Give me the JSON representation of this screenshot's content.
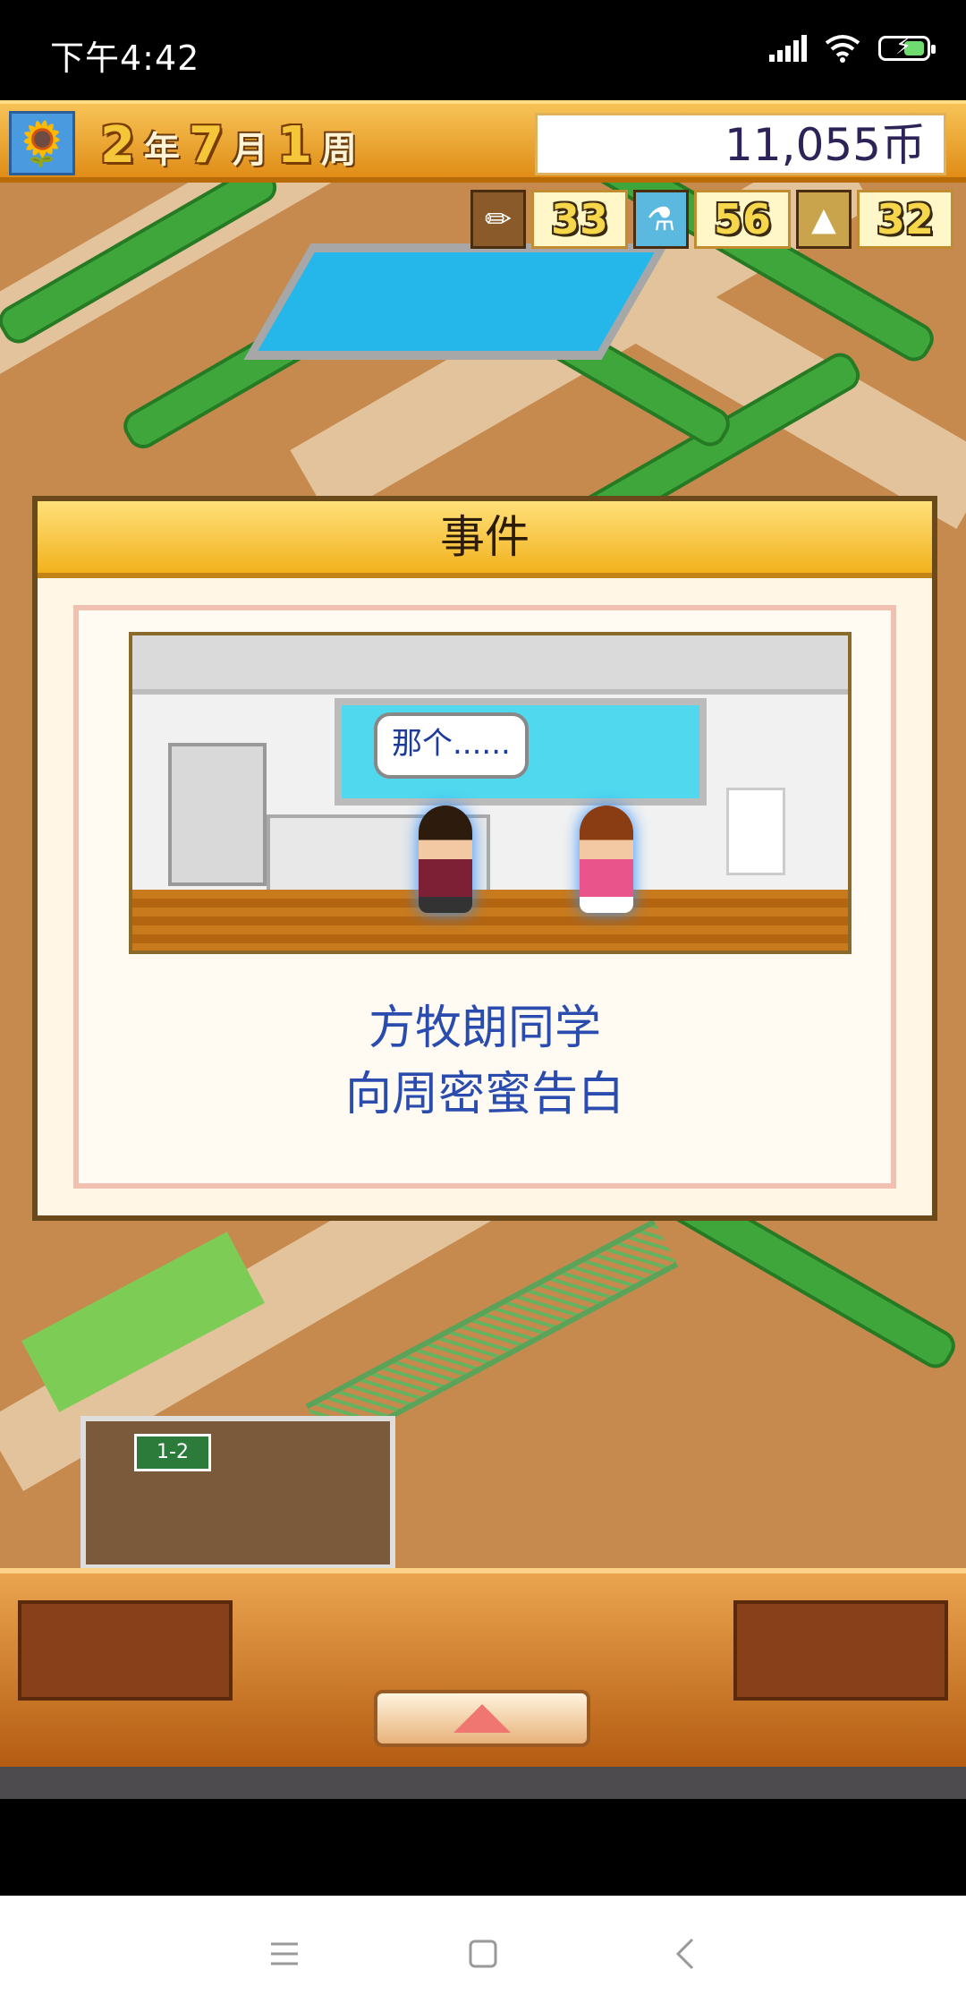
{
  "status_bar": {
    "time": "下午4:42"
  },
  "header": {
    "year": "2",
    "year_unit": "年",
    "month": "7",
    "month_unit": "月",
    "week": "1",
    "week_unit": "周",
    "money": "11,055币"
  },
  "stats": {
    "study": "33",
    "science": "56",
    "tower": "32"
  },
  "event_dialog": {
    "title": "事件",
    "speech": "那个......",
    "line1": "方牧朗同学",
    "line2": "向周密蜜告白"
  },
  "map": {
    "classroom_sign": "1-2"
  },
  "colors": {
    "header_gold": "#f2b21d",
    "message_blue": "#2a4cae",
    "bottom_orange": "#b45c12"
  }
}
